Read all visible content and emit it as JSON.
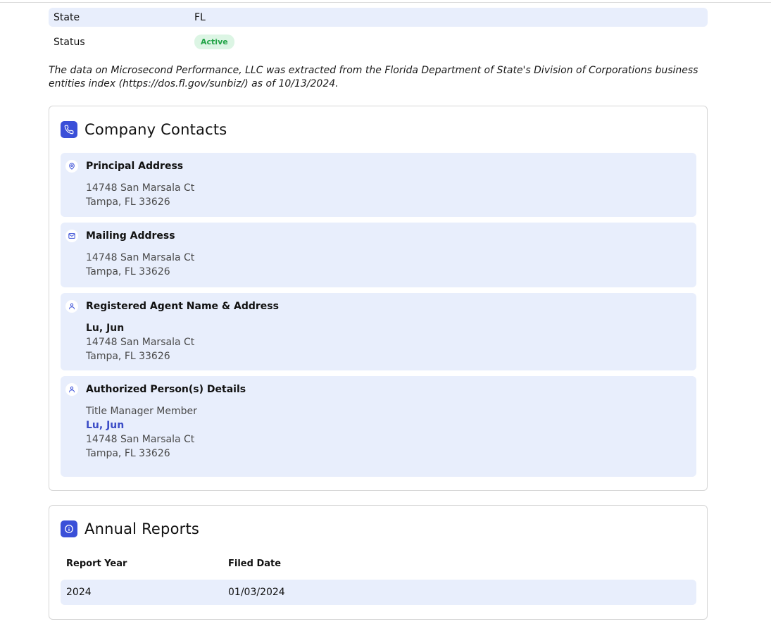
{
  "summary": {
    "state": {
      "label": "State",
      "value": "FL"
    },
    "status": {
      "label": "Status",
      "value": "Active"
    }
  },
  "disclaimer": "The data on Microsecond Performance, LLC was extracted from the Florida Department of State's Division of Corporations business entities index (https://dos.fl.gov/sunbiz/) as of 10/13/2024.",
  "contacts": {
    "title": "Company Contacts",
    "icon": "phone-icon",
    "principal": {
      "title": "Principal Address",
      "icon": "location-pin-icon",
      "line1": "14748 San Marsala Ct",
      "line2": "Tampa, FL 33626"
    },
    "mailing": {
      "title": "Mailing Address",
      "icon": "mail-icon",
      "line1": "14748 San Marsala Ct",
      "line2": "Tampa, FL 33626"
    },
    "agent": {
      "title": "Registered Agent Name & Address",
      "icon": "person-icon",
      "name": "Lu, Jun",
      "line1": "14748 San Marsala Ct",
      "line2": "Tampa, FL 33626"
    },
    "authorized": {
      "title": "Authorized Person(s) Details",
      "icon": "person-icon",
      "role": "Title Manager Member",
      "name": "Lu, Jun",
      "line1": "14748 San Marsala Ct",
      "line2": "Tampa, FL 33626"
    }
  },
  "reports": {
    "title": "Annual Reports",
    "icon": "info-icon",
    "columns": [
      "Report Year",
      "Filed Date"
    ],
    "rows": [
      {
        "year": "2024",
        "filed": "01/03/2024"
      }
    ]
  },
  "colors": {
    "accent": "#3a4fd8",
    "section_bg": "#e8eefc",
    "active_badge_bg": "#dcf5e4",
    "active_badge_text": "#22a447",
    "link": "#3b4cc6"
  }
}
